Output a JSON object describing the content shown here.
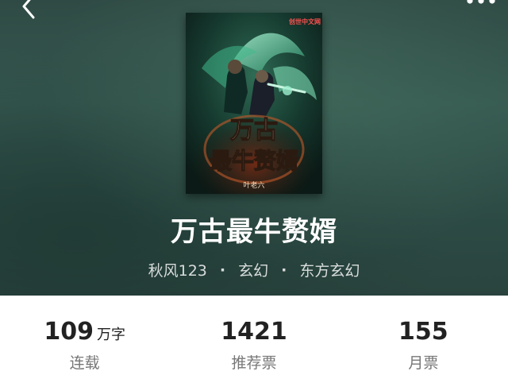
{
  "header": {
    "back_icon": "chevron-left-icon",
    "more_icon": "more-dots-icon"
  },
  "book": {
    "cover": {
      "publisher_badge": "创世中文网",
      "title_line1": "万古",
      "title_line2": "最牛赘婿",
      "author_mark": "叶老六"
    },
    "title": "万古最牛赘婿",
    "author": "秋风123",
    "separator": "·",
    "genre": "玄幻",
    "subgenre": "东方玄幻"
  },
  "stats": [
    {
      "value": "109",
      "unit": "万字",
      "label": "连载"
    },
    {
      "value": "1421",
      "unit": "",
      "label": "推荐票"
    },
    {
      "value": "155",
      "unit": "",
      "label": "月票"
    }
  ],
  "colors": {
    "hero_bg": "#2f4a44",
    "title_text": "#ffffff",
    "stat_value": "#222222",
    "stat_label": "#777777"
  }
}
